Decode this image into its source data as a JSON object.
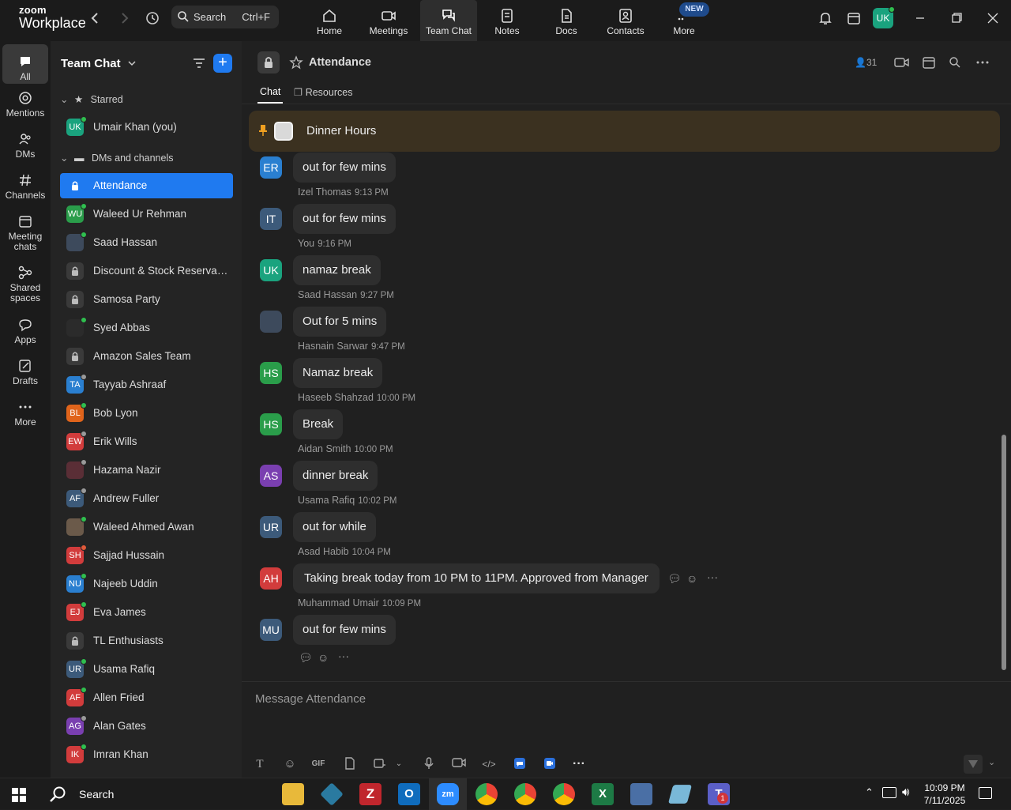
{
  "topbar": {
    "logo_line1": "zoom",
    "logo_line2": "Workplace",
    "search_label": "Search",
    "search_shortcut": "Ctrl+F",
    "new_badge": "NEW",
    "user_initials": "UK",
    "tabs": [
      {
        "label": "Home",
        "icon": "home-icon"
      },
      {
        "label": "Meetings",
        "icon": "video-icon"
      },
      {
        "label": "Team Chat",
        "icon": "chat-icon"
      },
      {
        "label": "Notes",
        "icon": "notes-icon"
      },
      {
        "label": "Docs",
        "icon": "docs-icon"
      },
      {
        "label": "Contacts",
        "icon": "contacts-icon"
      },
      {
        "label": "More",
        "icon": "more-icon"
      }
    ],
    "active_tab": "Team Chat"
  },
  "rail": [
    {
      "label": "All",
      "icon": "chat-bubble-icon"
    },
    {
      "label": "Mentions",
      "icon": "at-icon"
    },
    {
      "label": "DMs",
      "icon": "people-icon"
    },
    {
      "label": "Channels",
      "icon": "hash-icon"
    },
    {
      "label": "Meeting",
      "label2": "chats",
      "icon": "calendar-icon"
    },
    {
      "label": "Shared",
      "label2": "spaces",
      "icon": "share-icon"
    },
    {
      "label": "Apps",
      "icon": "apps-icon"
    },
    {
      "label": "Drafts",
      "icon": "draft-icon"
    },
    {
      "label": "More",
      "icon": "ellipsis-icon"
    }
  ],
  "sidebar": {
    "title": "Team Chat",
    "starred_label": "Starred",
    "starred": [
      {
        "name": "Umair Khan (you)",
        "initials": "UK",
        "color": "#1aa37e",
        "status": "#2fbf4f"
      }
    ],
    "dms_label": "DMs and channels",
    "items": [
      {
        "name": "Attendance",
        "kind": "lock",
        "selected": true
      },
      {
        "name": "Waleed Ur Rehman",
        "initials": "WU",
        "color": "#2a9d4a",
        "status": "#2fbf4f"
      },
      {
        "name": "Saad Hassan",
        "initials": "",
        "color": "#3d4a5c",
        "status": "#2fbf4f"
      },
      {
        "name": "Discount & Stock Reservati...",
        "kind": "lock"
      },
      {
        "name": "Samosa Party",
        "kind": "lock"
      },
      {
        "name": "Syed Abbas",
        "initials": "",
        "color": "#2b2b2b",
        "status": "#2fbf4f"
      },
      {
        "name": "Amazon Sales Team",
        "kind": "lock"
      },
      {
        "name": "Tayyab Ashraaf",
        "initials": "TA",
        "color": "#2a7fd0",
        "status": "#9a9a9a"
      },
      {
        "name": "Bob Lyon",
        "initials": "BL",
        "color": "#e0641b",
        "status": "#2fbf4f"
      },
      {
        "name": "Erik Wills",
        "initials": "EW",
        "color": "#d23c3c",
        "status": "#9a9a9a"
      },
      {
        "name": "Hazama Nazir",
        "initials": "",
        "color": "#5a2e36",
        "status": "#9a9a9a"
      },
      {
        "name": "Andrew Fuller",
        "initials": "AF",
        "color": "#3c5a7a",
        "status": "#9a9a9a"
      },
      {
        "name": "Waleed Ahmed Awan",
        "initials": "",
        "color": "#6b5a4a",
        "status": "#2fbf4f"
      },
      {
        "name": "Sajjad Hussain",
        "initials": "SH",
        "color": "#d23c3c",
        "status": "#e05a3a"
      },
      {
        "name": "Najeeb Uddin",
        "initials": "NU",
        "color": "#2a7fd0",
        "status": "#2fbf4f"
      },
      {
        "name": "Eva James",
        "initials": "EJ",
        "color": "#d23c3c",
        "status": "#2fbf4f"
      },
      {
        "name": "TL Enthusiasts",
        "kind": "lock"
      },
      {
        "name": "Usama Rafiq",
        "initials": "UR",
        "color": "#3c5a7a",
        "status": "#2fbf4f"
      },
      {
        "name": "Allen Fried",
        "initials": "AF",
        "color": "#d23c3c",
        "status": "#2fbf4f"
      },
      {
        "name": "Alan Gates",
        "initials": "AG",
        "color": "#7a3fb0",
        "status": "#9a9a9a"
      },
      {
        "name": "Imran Khan",
        "initials": "IK",
        "color": "#d23c3c",
        "status": "#2fbf4f"
      }
    ]
  },
  "channel": {
    "title": "Attendance",
    "member_count": "31",
    "tabs": [
      "Chat",
      "Resources"
    ],
    "pinned": "Dinner Hours",
    "composer_placeholder": "Message Attendance",
    "messages": [
      {
        "sender": "",
        "time": "",
        "initials": "ER",
        "color": "#2a7fd0",
        "text": "out for few mins"
      },
      {
        "sender": "Izel Thomas",
        "time": "9:13 PM",
        "initials": "IT",
        "color": "#3c5a7a",
        "text": "out for few mins"
      },
      {
        "sender": "You",
        "time": "9:16 PM",
        "initials": "UK",
        "color": "#1aa37e",
        "text": "namaz break"
      },
      {
        "sender": "Saad Hassan",
        "time": "9:27 PM",
        "initials": "",
        "color": "#3d4a5c",
        "text": "Out for 5 mins"
      },
      {
        "sender": "Hasnain Sarwar",
        "time": "9:47 PM",
        "initials": "HS",
        "color": "#2a9d4a",
        "text": "Namaz break"
      },
      {
        "sender": "Haseeb Shahzad",
        "time": "10:00 PM",
        "initials": "HS",
        "color": "#2a9d4a",
        "text": "Break"
      },
      {
        "sender": "Aidan Smith",
        "time": "10:00 PM",
        "initials": "AS",
        "color": "#7a3fb0",
        "text": "dinner break"
      },
      {
        "sender": "Usama Rafiq",
        "time": "10:02 PM",
        "initials": "UR",
        "color": "#3c5a7a",
        "text": "out for while"
      },
      {
        "sender": "Asad Habib",
        "time": "10:04 PM",
        "initials": "AH",
        "color": "#d23c3c",
        "text": "Taking break today from 10 PM to 11PM. Approved from Manager"
      },
      {
        "sender": "Muhammad Umair",
        "time": "10:09 PM",
        "initials": "MU",
        "color": "#3c5a7a",
        "text": "out for few mins"
      }
    ]
  },
  "taskbar": {
    "search_label": "Search",
    "time": "10:09 PM",
    "date": "7/11/2025",
    "teams_badge": "1"
  }
}
